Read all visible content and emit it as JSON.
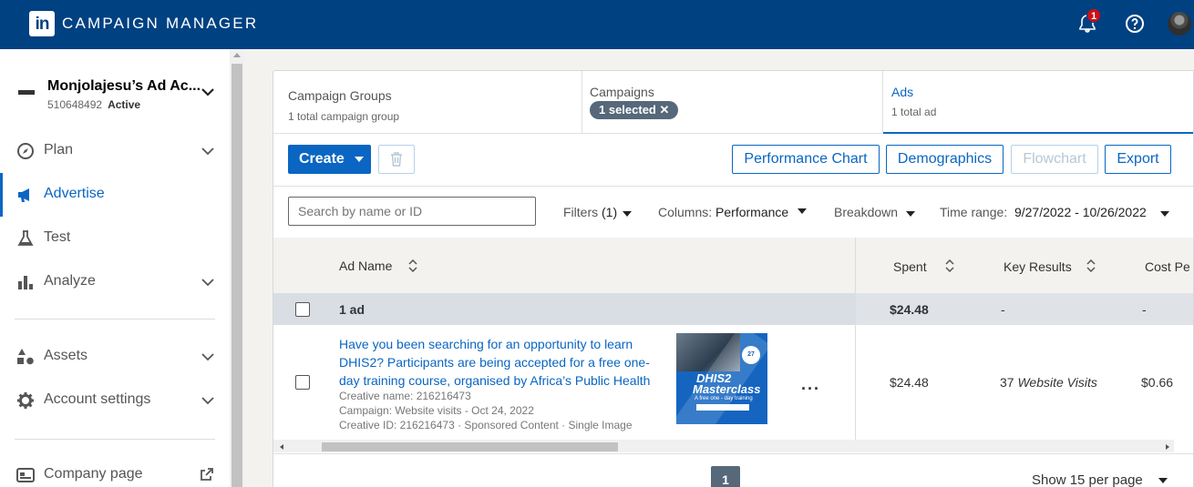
{
  "header": {
    "logo_text": "in",
    "title": "CAMPAIGN MANAGER",
    "notification_count": "1"
  },
  "sidebar": {
    "account": {
      "name": "Monjolajesu’s Ad Ac...",
      "id": "510648492",
      "status": "Active"
    },
    "items": [
      {
        "label": "Plan",
        "icon": "compass-icon"
      },
      {
        "label": "Advertise",
        "icon": "megaphone-icon"
      },
      {
        "label": "Test",
        "icon": "flask-icon"
      },
      {
        "label": "Analyze",
        "icon": "bar-chart-icon"
      },
      {
        "label": "Assets",
        "icon": "shapes-icon"
      },
      {
        "label": "Account settings",
        "icon": "gear-icon"
      },
      {
        "label": "Company page",
        "icon": "company-page-icon"
      }
    ]
  },
  "tabs": {
    "groups": {
      "title": "Campaign Groups",
      "sub": "1 total campaign group"
    },
    "campaigns": {
      "title": "Campaigns",
      "pill": "1 selected"
    },
    "ads": {
      "title": "Ads",
      "sub": "1 total ad"
    }
  },
  "toolbar": {
    "create": "Create",
    "performance_chart": "Performance Chart",
    "demographics": "Demographics",
    "flowchart": "Flowchart",
    "export": "Export"
  },
  "filters": {
    "search_placeholder": "Search by name or ID",
    "filters_label": "Filters",
    "filters_count": "(1)",
    "columns_label": "Columns:",
    "columns_value": "Performance",
    "breakdown_label": "Breakdown",
    "time_label": "Time range:",
    "time_value": "9/27/2022 - 10/26/2022"
  },
  "table": {
    "headers": {
      "ad_name": "Ad Name",
      "spent": "Spent",
      "key_results": "Key Results",
      "cost_per": "Cost Pe"
    },
    "group_row": {
      "label": "1 ad",
      "spent": "$24.48",
      "key_results": "-",
      "cost_per": "-"
    },
    "rows": [
      {
        "title": "Have you been searching for an opportunity to learn DHIS2?  Participants are being accepted for a free one-day training course, organised by Africa’s Public Health",
        "creative_name": "Creative name: 216216473",
        "campaign": "Campaign: Website visits - Oct 24, 2022",
        "creative_id": "Creative ID: 216216473 · Sponsored Content · Single Image",
        "thumb_line1": "DHIS2",
        "thumb_line2": "Masterclass",
        "thumb_line3": "A free one - day training",
        "thumb_date": "27",
        "spent": "$24.48",
        "key_results_num": "37",
        "key_results_unit": "Website Visits",
        "cost_per": "$0.66"
      }
    ]
  },
  "pagination": {
    "page": "1",
    "per_page": "Show 15 per page"
  }
}
